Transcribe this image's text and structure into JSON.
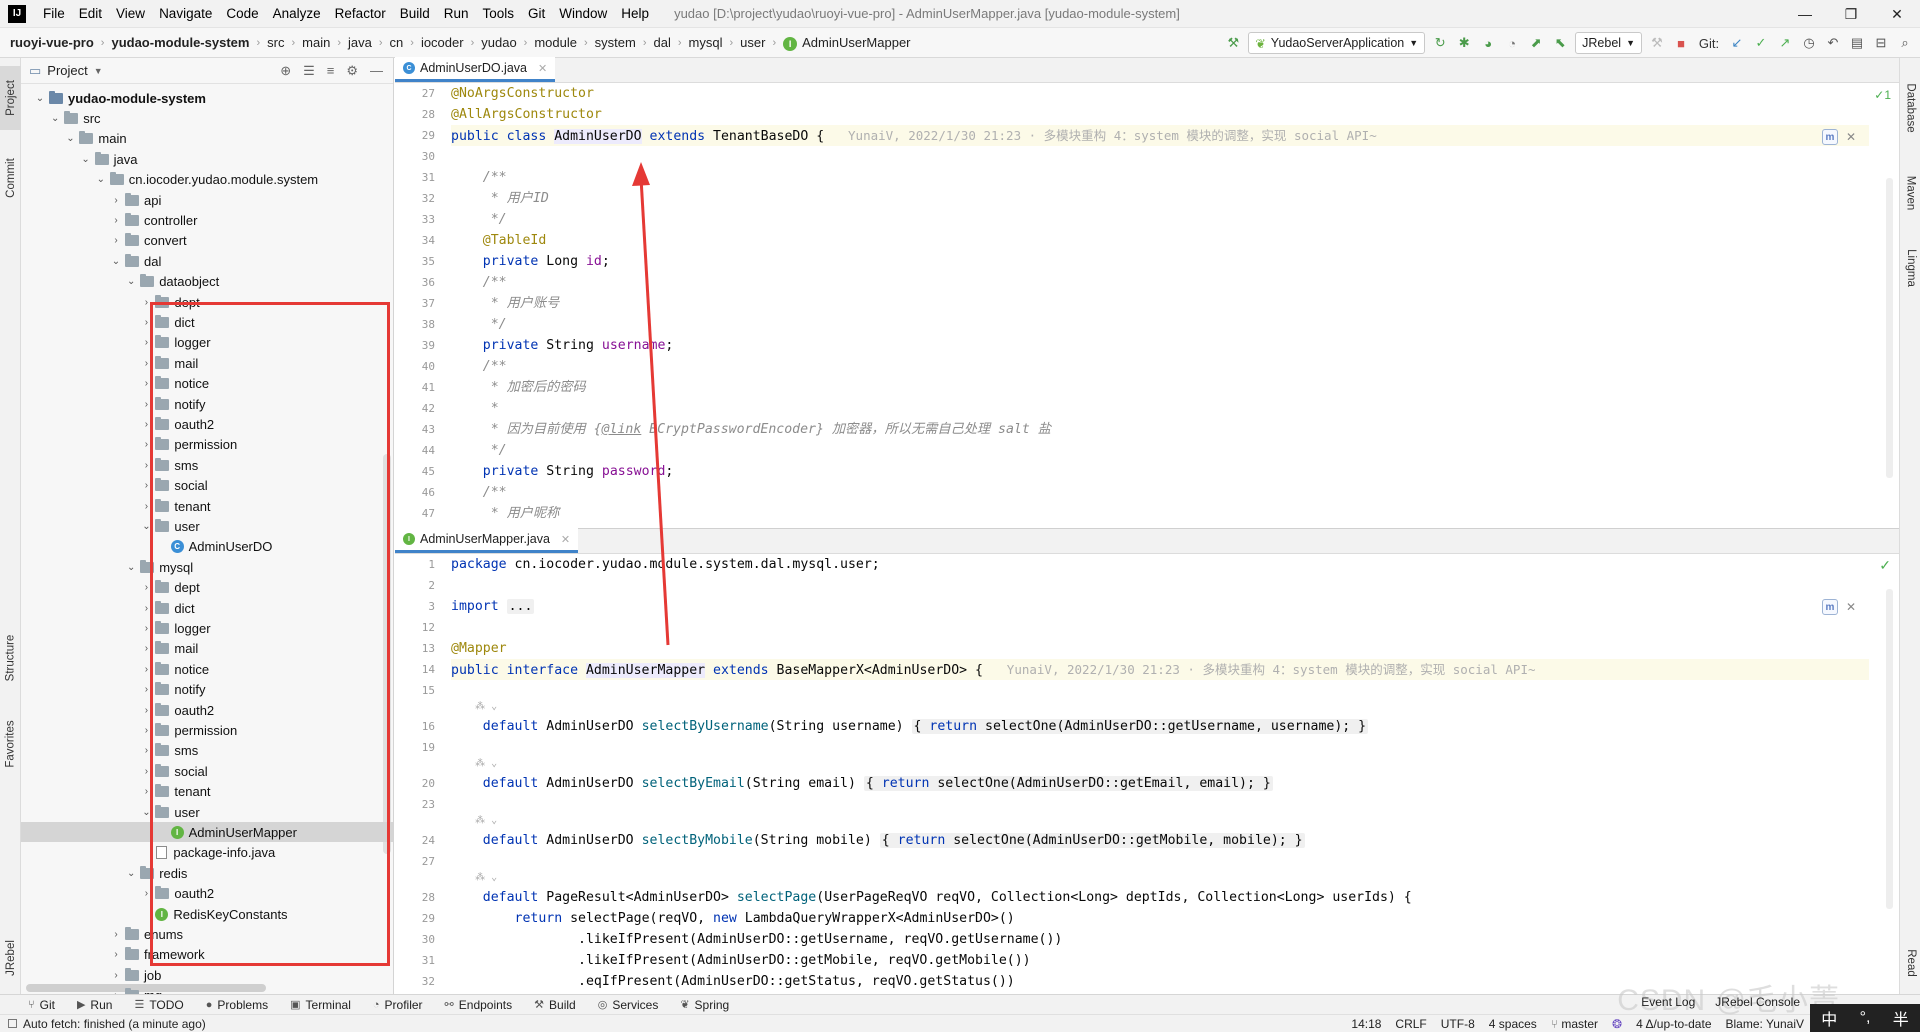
{
  "menubar": {
    "logo": "IJ",
    "items": [
      "File",
      "Edit",
      "View",
      "Navigate",
      "Code",
      "Analyze",
      "Refactor",
      "Build",
      "Run",
      "Tools",
      "Git",
      "Window",
      "Help"
    ],
    "window_title": "yudao [D:\\project\\yudao\\ruoyi-vue-pro] - AdminUserMapper.java [yudao-module-system]",
    "controls": [
      "—",
      "❐",
      "✕"
    ]
  },
  "navbar": {
    "crumbs": [
      "ruoyi-vue-pro",
      "yudao-module-system",
      "src",
      "main",
      "java",
      "cn",
      "iocoder",
      "yudao",
      "module",
      "system",
      "dal",
      "mysql",
      "user",
      "AdminUserMapper"
    ],
    "run_config": "YudaoServerApplication",
    "jrebel": "JRebel",
    "git_label": "Git:"
  },
  "left_stripe": {
    "project": "Project",
    "commit": "Commit",
    "structure": "Structure",
    "favorites": "Favorites",
    "jrebel": "JRebel"
  },
  "right_stripe": {
    "database": "Database",
    "maven": "Maven",
    "lingma": "Lingma",
    "read": "Read"
  },
  "project_panel": {
    "title": "Project",
    "tree": [
      {
        "label": "yudao-module-system",
        "depth": 0,
        "kind": "module",
        "expanded": true,
        "bold": true
      },
      {
        "label": "src",
        "depth": 1,
        "kind": "folder",
        "expanded": true
      },
      {
        "label": "main",
        "depth": 2,
        "kind": "folder",
        "expanded": true
      },
      {
        "label": "java",
        "depth": 3,
        "kind": "folder",
        "expanded": true
      },
      {
        "label": "cn.iocoder.yudao.module.system",
        "depth": 4,
        "kind": "package",
        "expanded": true
      },
      {
        "label": "api",
        "depth": 5,
        "kind": "package",
        "expanded": false
      },
      {
        "label": "controller",
        "depth": 5,
        "kind": "package",
        "expanded": false
      },
      {
        "label": "convert",
        "depth": 5,
        "kind": "package",
        "expanded": false
      },
      {
        "label": "dal",
        "depth": 5,
        "kind": "package",
        "expanded": true
      },
      {
        "label": "dataobject",
        "depth": 6,
        "kind": "package",
        "expanded": true
      },
      {
        "label": "dept",
        "depth": 7,
        "kind": "package",
        "expanded": false
      },
      {
        "label": "dict",
        "depth": 7,
        "kind": "package",
        "expanded": false
      },
      {
        "label": "logger",
        "depth": 7,
        "kind": "package",
        "expanded": false
      },
      {
        "label": "mail",
        "depth": 7,
        "kind": "package",
        "expanded": false
      },
      {
        "label": "notice",
        "depth": 7,
        "kind": "package",
        "expanded": false
      },
      {
        "label": "notify",
        "depth": 7,
        "kind": "package",
        "expanded": false
      },
      {
        "label": "oauth2",
        "depth": 7,
        "kind": "package",
        "expanded": false
      },
      {
        "label": "permission",
        "depth": 7,
        "kind": "package",
        "expanded": false
      },
      {
        "label": "sms",
        "depth": 7,
        "kind": "package",
        "expanded": false
      },
      {
        "label": "social",
        "depth": 7,
        "kind": "package",
        "expanded": false
      },
      {
        "label": "tenant",
        "depth": 7,
        "kind": "package",
        "expanded": false
      },
      {
        "label": "user",
        "depth": 7,
        "kind": "package",
        "expanded": true
      },
      {
        "label": "AdminUserDO",
        "depth": 8,
        "kind": "class"
      },
      {
        "label": "mysql",
        "depth": 6,
        "kind": "package",
        "expanded": true
      },
      {
        "label": "dept",
        "depth": 7,
        "kind": "package",
        "expanded": false
      },
      {
        "label": "dict",
        "depth": 7,
        "kind": "package",
        "expanded": false
      },
      {
        "label": "logger",
        "depth": 7,
        "kind": "package",
        "expanded": false
      },
      {
        "label": "mail",
        "depth": 7,
        "kind": "package",
        "expanded": false
      },
      {
        "label": "notice",
        "depth": 7,
        "kind": "package",
        "expanded": false
      },
      {
        "label": "notify",
        "depth": 7,
        "kind": "package",
        "expanded": false
      },
      {
        "label": "oauth2",
        "depth": 7,
        "kind": "package",
        "expanded": false
      },
      {
        "label": "permission",
        "depth": 7,
        "kind": "package",
        "expanded": false
      },
      {
        "label": "sms",
        "depth": 7,
        "kind": "package",
        "expanded": false
      },
      {
        "label": "social",
        "depth": 7,
        "kind": "package",
        "expanded": false
      },
      {
        "label": "tenant",
        "depth": 7,
        "kind": "package",
        "expanded": false
      },
      {
        "label": "user",
        "depth": 7,
        "kind": "package",
        "expanded": true
      },
      {
        "label": "AdminUserMapper",
        "depth": 8,
        "kind": "interface",
        "selected": true
      },
      {
        "label": "package-info.java",
        "depth": 7,
        "kind": "file"
      },
      {
        "label": "redis",
        "depth": 6,
        "kind": "package",
        "expanded": true
      },
      {
        "label": "oauth2",
        "depth": 7,
        "kind": "package",
        "expanded": false
      },
      {
        "label": "RedisKeyConstants",
        "depth": 7,
        "kind": "interface"
      },
      {
        "label": "enums",
        "depth": 5,
        "kind": "package",
        "expanded": false
      },
      {
        "label": "framework",
        "depth": 5,
        "kind": "package",
        "expanded": false
      },
      {
        "label": "job",
        "depth": 5,
        "kind": "package",
        "expanded": false
      },
      {
        "label": "mq",
        "depth": 5,
        "kind": "package",
        "expanded": false
      }
    ]
  },
  "editor_top": {
    "tab": "AdminUserDO.java",
    "line_numbers": [
      "27",
      "28",
      "29",
      "30",
      "31",
      "32",
      "33",
      "34",
      "35",
      "36",
      "37",
      "38",
      "39",
      "40",
      "41",
      "42",
      "43",
      "44",
      "45",
      "46",
      "47"
    ],
    "inspection": "✓1",
    "blame_hint": "YunaiV, 2022/1/30 21:23 · 多模块重构 4：system 模块的调整，实现 social API~"
  },
  "editor_bottom": {
    "tab": "AdminUserMapper.java",
    "line_numbers": [
      "1",
      "2",
      "3",
      "12",
      "13",
      "14",
      "15",
      "",
      "16",
      "19",
      "",
      "20",
      "23",
      "",
      "24",
      "27",
      "",
      "28",
      "29",
      "30",
      "31",
      "32"
    ],
    "blame_hint": "YunaiV, 2022/1/30 21:23 · 多模块重构 4：system 模块的调整，实现 social API~"
  },
  "tool_windows": [
    {
      "icon": "⑂",
      "label": "Git"
    },
    {
      "icon": "▶",
      "label": "Run"
    },
    {
      "icon": "☰",
      "label": "TODO"
    },
    {
      "icon": "●",
      "label": "Problems"
    },
    {
      "icon": "▣",
      "label": "Terminal"
    },
    {
      "icon": "◔",
      "label": "Profiler"
    },
    {
      "icon": "⚯",
      "label": "Endpoints"
    },
    {
      "icon": "⚒",
      "label": "Build"
    },
    {
      "icon": "◎",
      "label": "Services"
    },
    {
      "icon": "❦",
      "label": "Spring"
    }
  ],
  "tool_windows_right": {
    "event_log": "Event Log",
    "jrebel_console": "JRebel Console"
  },
  "statusbar": {
    "left": "Auto fetch: finished (a minute ago)",
    "caret": "14:18",
    "line_sep": "CRLF",
    "encoding": "UTF-8",
    "indent": "4 spaces",
    "branch": "master",
    "git_status": "4 Δ/up-to-date",
    "blame": "Blame: YunaiV"
  },
  "watermark": "CSDN @毛小菁",
  "ime": {
    "lang": "中",
    "punct": "°,",
    "width": "半"
  },
  "colors": {
    "highlight_box": "#e53935",
    "arrow": "#e53935",
    "keyword": "#0033b3",
    "annotation": "#9e880d",
    "comment": "#8c8c8c",
    "method": "#00627a",
    "field": "#871094"
  }
}
